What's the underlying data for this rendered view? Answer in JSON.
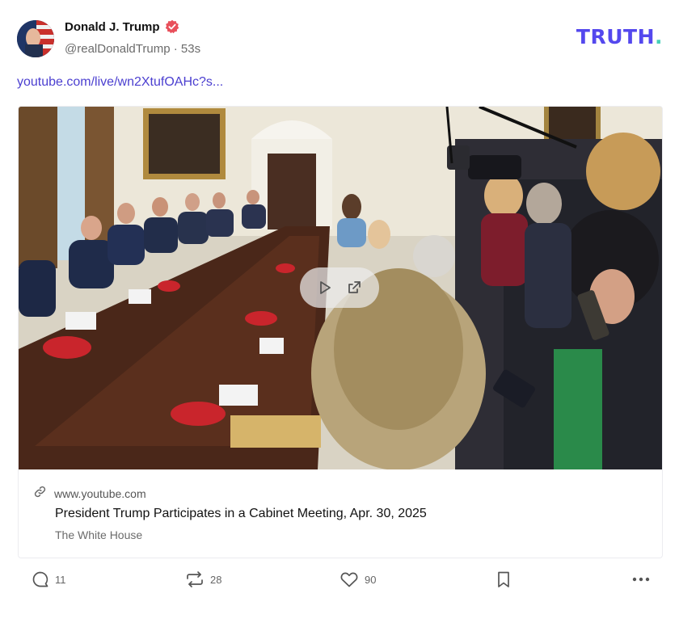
{
  "post": {
    "author_name": "Donald J. Trump",
    "handle_line": "@realDonaldTrump · 53s",
    "avatar_icon": "flag-avatar",
    "verified_icon": "verified-badge-icon",
    "verified_color": "#e8505b",
    "link_text": "youtube.com/live/wn2XtufOAHc?s..."
  },
  "brand": {
    "logo_text": "TRUTH",
    "logo_dot": ".",
    "logo_color": "#5448ee",
    "dot_color": "#46d0b8"
  },
  "card": {
    "image_alt": "Cabinet meeting room with people seated around a long table",
    "domain": "www.youtube.com",
    "title": "President Trump Participates in a Cabinet Meeting, Apr. 30, 2025",
    "author": "The White House",
    "play_icon": "play-icon",
    "open_icon": "external-link-icon",
    "link_icon": "link-icon"
  },
  "actions": {
    "replies": "11",
    "retruths": "28",
    "likes": "90",
    "reply_icon": "comment-icon",
    "retruth_icon": "repost-icon",
    "like_icon": "heart-icon",
    "bookmark_icon": "bookmark-icon",
    "more_icon": "more-icon"
  }
}
